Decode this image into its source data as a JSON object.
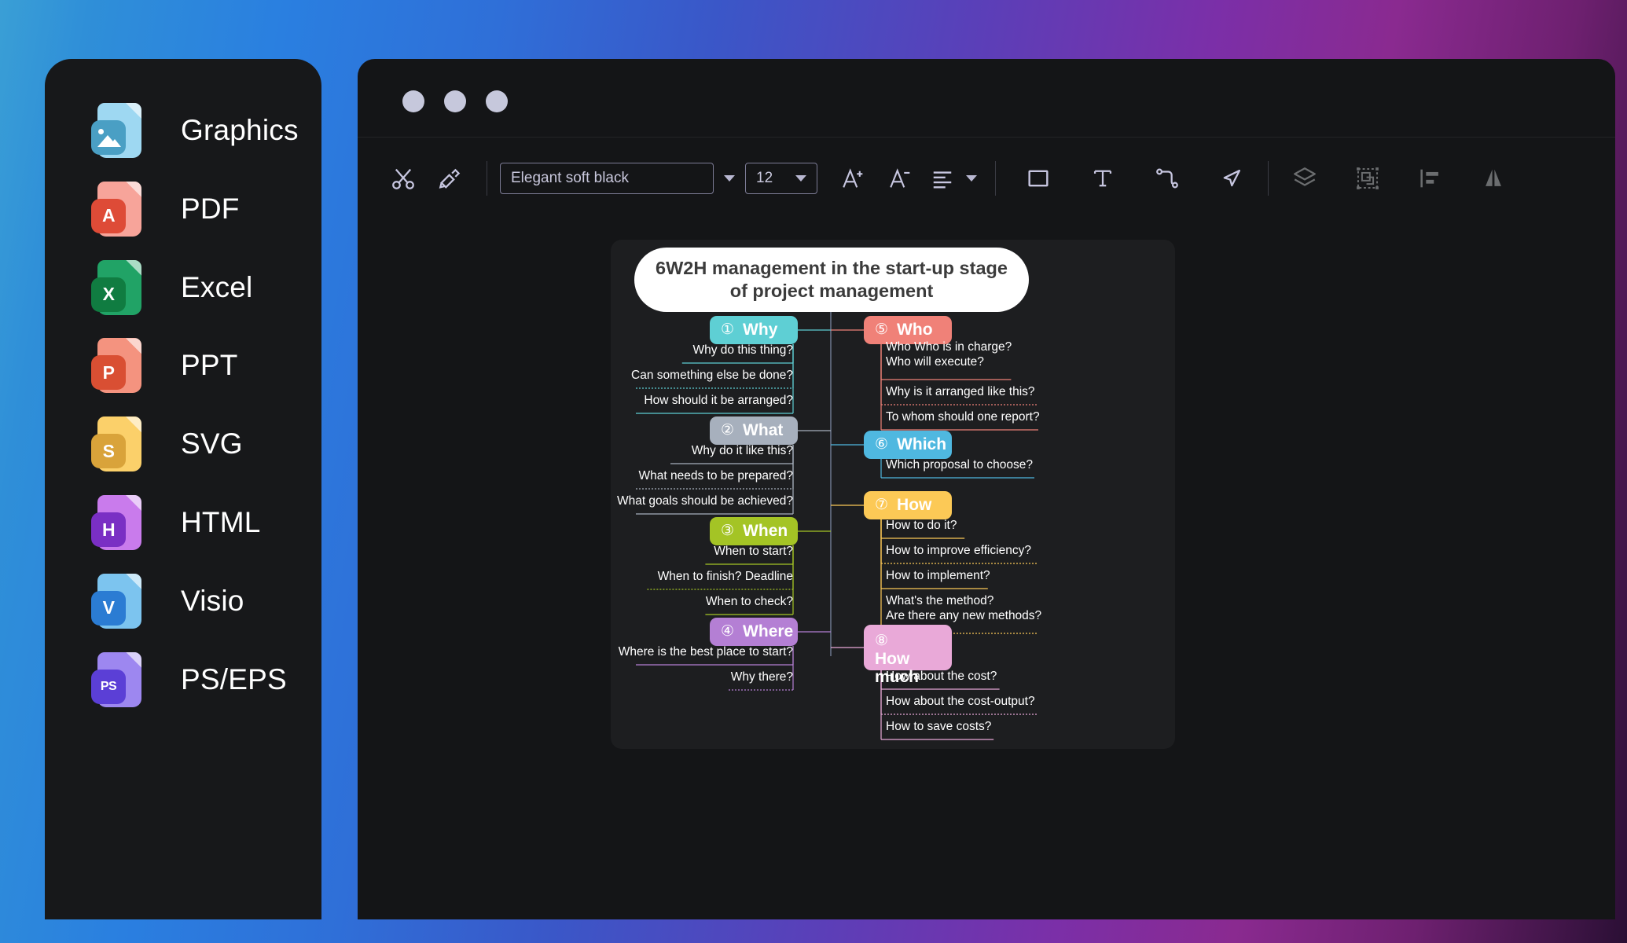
{
  "app": {
    "background_gradient": [
      "#3a9fd6",
      "#2a7fe0",
      "#7b2fa8",
      "#2a0f34"
    ]
  },
  "sidebar": {
    "items": [
      {
        "label": "Graphics",
        "icon": "graphics-file-icon",
        "badge": "",
        "sheet_color": "#9ed8f2",
        "badge_color": "#4a9fc4"
      },
      {
        "label": "PDF",
        "icon": "pdf-file-icon",
        "badge": "A",
        "sheet_color": "#f7a49a",
        "badge_color": "#de4b37"
      },
      {
        "label": "Excel",
        "icon": "excel-file-icon",
        "badge": "X",
        "sheet_color": "#21a366",
        "badge_color": "#107c41"
      },
      {
        "label": "PPT",
        "icon": "ppt-file-icon",
        "badge": "P",
        "sheet_color": "#f4937f",
        "badge_color": "#d94f33"
      },
      {
        "label": "SVG",
        "icon": "svg-file-icon",
        "badge": "S",
        "sheet_color": "#fbd06a",
        "badge_color": "#d9a33a"
      },
      {
        "label": "HTML",
        "icon": "html-file-icon",
        "badge": "H",
        "sheet_color": "#c97bec",
        "badge_color": "#7a2fc4"
      },
      {
        "label": "Visio",
        "icon": "visio-file-icon",
        "badge": "V",
        "sheet_color": "#7cc4ef",
        "badge_color": "#2b7cd3"
      },
      {
        "label": "PS/EPS",
        "icon": "ps-file-icon",
        "badge": "PS",
        "sheet_color": "#9d87f0",
        "badge_color": "#5b3fd6"
      }
    ]
  },
  "window": {
    "traffic_lights": [
      "close",
      "minimize",
      "maximize"
    ],
    "toolbar": {
      "cut_label": "Cut",
      "format_painter_label": "Format Painter",
      "style_field_value": "Elegant soft black",
      "style_field_placeholder": "Elegant soft black",
      "style_dropdown_label": "Style dropdown",
      "font_size_value": "12",
      "increase_font_label": "Increase font size",
      "decrease_font_label": "Decrease font size",
      "align_label": "Alignment",
      "shape_label": "Shape",
      "text_label": "Text box",
      "connector_label": "Connector",
      "pointer_label": "Select",
      "layers_label": "Layers",
      "group_label": "Group",
      "align_left_label": "Align left",
      "flip_label": "Flip"
    }
  },
  "chart_data": {
    "type": "diagram",
    "diagram_type": "mind-map",
    "title": "6W2H management in the start-up stage of project management",
    "layout": "two-sided horizontal tree",
    "branches": [
      {
        "number": "①",
        "label": "Why",
        "color": "#5ecfd4",
        "side": "left",
        "items": [
          "Why do this thing?",
          "Can something else be done?",
          "How should it be arranged?"
        ]
      },
      {
        "number": "②",
        "label": "What",
        "color": "#a7b0bd",
        "side": "left",
        "items": [
          "Why do it like this?",
          "What needs to be prepared?",
          "What goals should be achieved?"
        ]
      },
      {
        "number": "③",
        "label": "When",
        "color": "#a4c425",
        "side": "left",
        "items": [
          "When to start?",
          "When to finish? Deadline",
          "When to check?"
        ]
      },
      {
        "number": "④",
        "label": "Where",
        "color": "#b47fd4",
        "side": "left",
        "items": [
          "Where is the best place to start?",
          "Why there?"
        ]
      },
      {
        "number": "⑤",
        "label": "Who",
        "color": "#f08178",
        "side": "right",
        "items": [
          "Who Who is in charge?\nWho will execute?",
          "Why is it arranged like this?",
          "To whom should one report?"
        ]
      },
      {
        "number": "⑥",
        "label": "Which",
        "color": "#4fb8e0",
        "side": "right",
        "items": [
          "Which proposal to choose?"
        ]
      },
      {
        "number": "⑦",
        "label": "How",
        "color": "#fcc956",
        "side": "right",
        "items": [
          "How to do it?",
          "How to improve efficiency?",
          "How to implement?",
          "What's the method?\nAre there any new methods?"
        ]
      },
      {
        "number": "⑧",
        "label": "How much",
        "color": "#e9a9d8",
        "side": "right",
        "items": [
          "How about the cost?",
          "How about the cost-output?",
          "How to save costs?"
        ]
      }
    ]
  }
}
